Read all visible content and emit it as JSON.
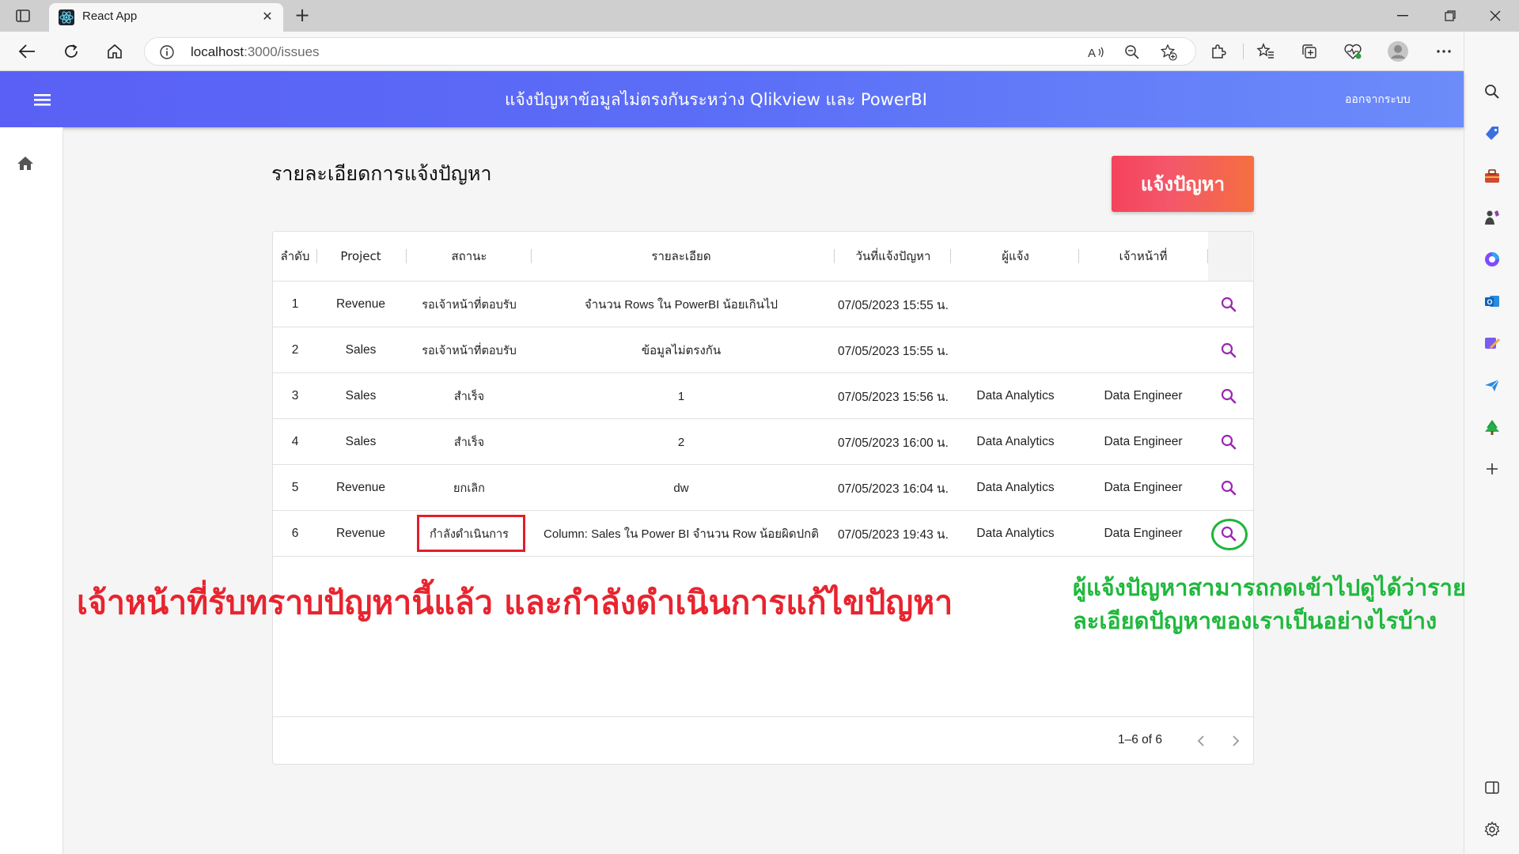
{
  "browser": {
    "tab_title": "React App",
    "url_host": "localhost",
    "url_rest": ":3000/issues"
  },
  "app": {
    "title": "แจ้งปัญหาข้อมูลไม่ตรงกันระหว่าง Qlikview และ PowerBI",
    "logout_label": "ออกจากระบบ",
    "page_title": "รายละเอียดการแจ้งปัญหา",
    "report_button": "แจ้งปัญหา",
    "accent_color": "#5a60f5",
    "icon_color": "#9c27b0"
  },
  "table": {
    "headers": [
      "ลำดับ",
      "Project",
      "สถานะ",
      "รายละเอียด",
      "วันที่แจ้งปัญหา",
      "ผู้แจ้ง",
      "เจ้าหน้าที่"
    ],
    "rows": [
      [
        "1",
        "Revenue",
        "รอเจ้าหน้าที่ตอบรับ",
        "จำนวน Rows ใน PowerBI น้อยเกินไป",
        "07/05/2023 15:55 น.",
        "",
        ""
      ],
      [
        "2",
        "Sales",
        "รอเจ้าหน้าที่ตอบรับ",
        "ข้อมูลไม่ตรงกัน",
        "07/05/2023 15:55 น.",
        "",
        ""
      ],
      [
        "3",
        "Sales",
        "สำเร็จ",
        "1",
        "07/05/2023 15:56 น.",
        "Data Analytics",
        "Data Engineer"
      ],
      [
        "4",
        "Sales",
        "สำเร็จ",
        "2",
        "07/05/2023 16:00 น.",
        "Data Analytics",
        "Data Engineer"
      ],
      [
        "5",
        "Revenue",
        "ยกเลิก",
        "dw",
        "07/05/2023 16:04 น.",
        "Data Analytics",
        "Data Engineer"
      ],
      [
        "6",
        "Revenue",
        "กำลังดำเนินการ",
        "Column: Sales ใน Power BI จำนวน Row น้อยผิดปกติ",
        "07/05/2023 19:43 น.",
        "Data Analytics",
        "Data Engineer"
      ]
    ],
    "pagination": "1–6 of 6"
  },
  "annotations": {
    "red_text": "เจ้าหน้าที่รับทราบปัญหานี้แล้ว และกำลังดำเนินการแก้ไขปัญหา",
    "green_line1": "ผู้แจ้งปัญหาสามารถกดเข้าไปดูได้ว่าราย",
    "green_line2": "ละเอียดปัญหาของเราเป็นอย่างไรบ้าง"
  }
}
